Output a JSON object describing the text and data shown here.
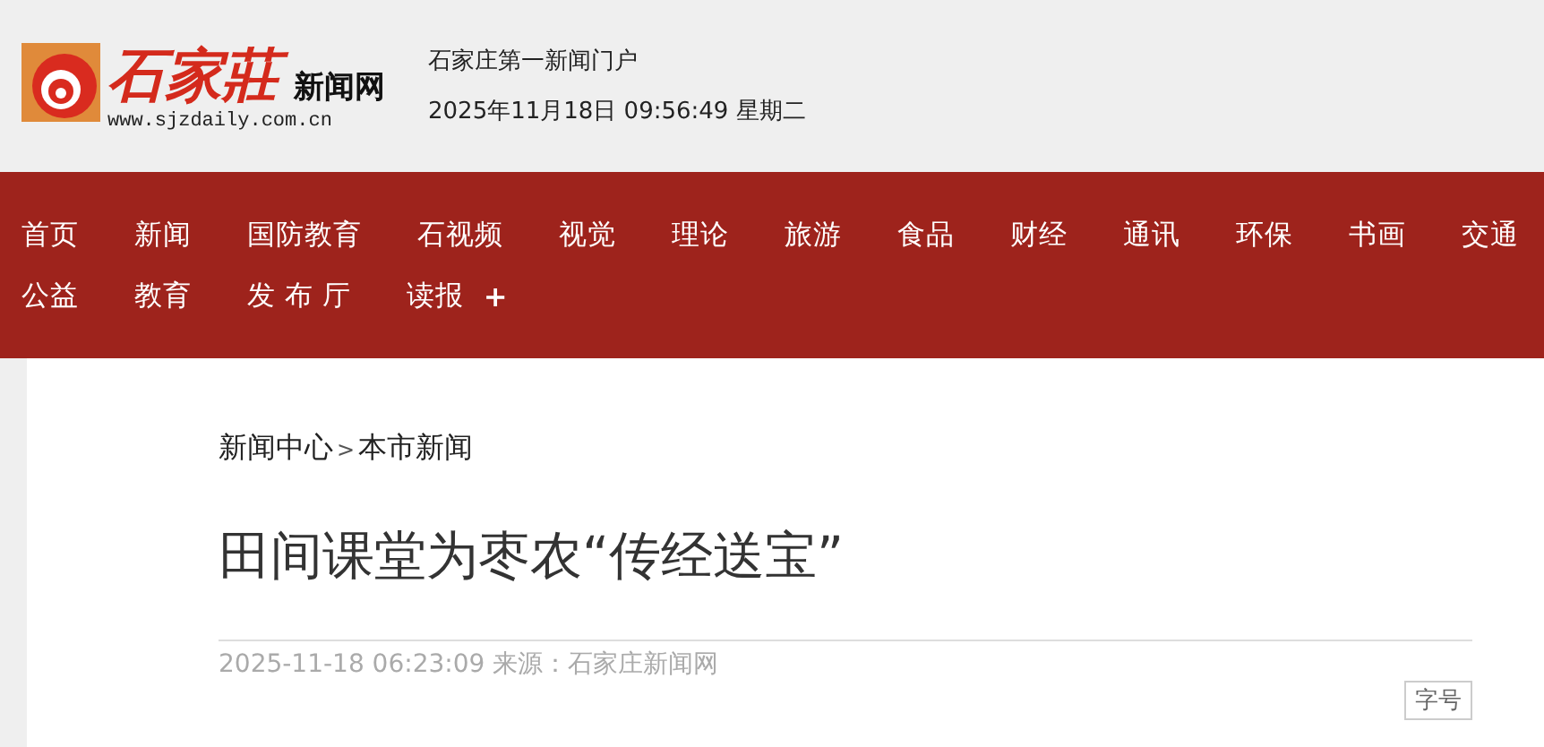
{
  "logo": {
    "name": "石家莊",
    "suffix": "新闻网",
    "url": "www.sjzdaily.com.cn"
  },
  "header": {
    "slogan": "石家庄第一新闻门户",
    "datetime": "2025年11月18日 09:56:49 星期二"
  },
  "nav": {
    "rows": [
      [
        "首页",
        "新闻",
        "国防教育",
        "石视频",
        "视觉",
        "理论",
        "旅游",
        "食品",
        "财经",
        "通讯",
        "环保",
        "书画",
        "交通"
      ],
      [
        "公益",
        "教育",
        "发 布 厅",
        "读报"
      ]
    ],
    "more": "+"
  },
  "breadcrumb": {
    "parent": "新闻中心",
    "separator": ">",
    "current": "本市新闻"
  },
  "article": {
    "title": "田间课堂为枣农“传经送宝”",
    "meta": "2025-11-18 06:23:09 来源：石家庄新闻网",
    "font_size_button": "字号"
  }
}
